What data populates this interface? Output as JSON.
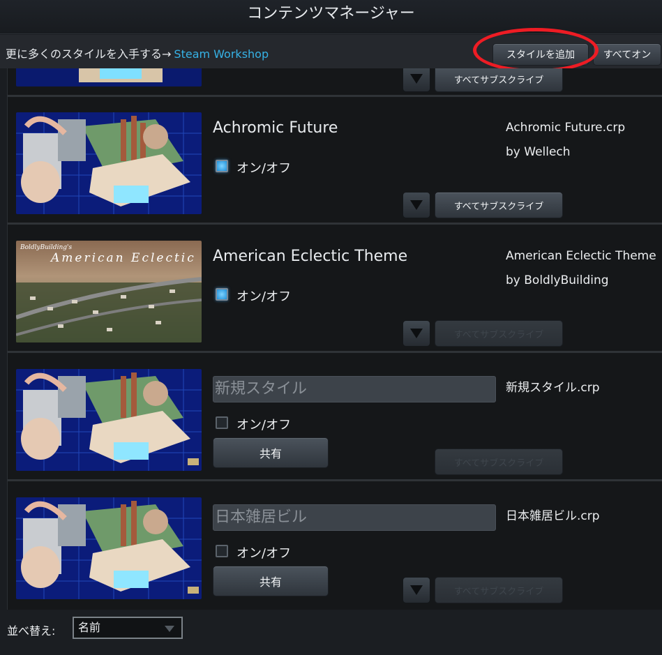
{
  "window": {
    "title": "コンテンツマネージャー"
  },
  "toolbar": {
    "more_styles_text": "更に多くのスタイルを入手する→",
    "workshop_link": "Steam Workshop",
    "add_style_label": "スタイルを追加",
    "all_on_label": "すべてオン"
  },
  "items": [
    {
      "title": "",
      "file": "",
      "author": "",
      "enabled": true,
      "subscribe_label": "すべてサブスクライブ"
    },
    {
      "title": "Achromic Future",
      "file": "Achromic Future.crp",
      "author": "by Wellech",
      "toggle_label": "オン/オフ",
      "enabled": true,
      "subscribe_label": "すべてサブスクライブ"
    },
    {
      "title": "American Eclectic Theme",
      "file": "American Eclectic Theme",
      "author": "by BoldlyBuilding",
      "toggle_label": "オン/オフ",
      "enabled": true,
      "subscribe_label": "すべてサブスクライブ",
      "thumb_text_1": "BoldlyBuilding's",
      "thumb_text_2": "American Eclectic"
    },
    {
      "title": "新規スタイル",
      "file": "新規スタイル.crp",
      "author": "",
      "toggle_label": "オン/オフ",
      "enabled": false,
      "share_label": "共有",
      "subscribe_label": "すべてサブスクライブ"
    },
    {
      "title": "日本雑居ビル",
      "file": "日本雑居ビル.crp",
      "author": "",
      "toggle_label": "オン/オフ",
      "enabled": false,
      "share_label": "共有",
      "subscribe_label": "すべてサブスクライブ"
    }
  ],
  "footer": {
    "sort_label": "並べ替え:",
    "sort_value": "名前"
  },
  "colors": {
    "accent": "#36b2e6",
    "highlight": "#ee1c24",
    "checkbox_on": "#1f8fd8"
  }
}
